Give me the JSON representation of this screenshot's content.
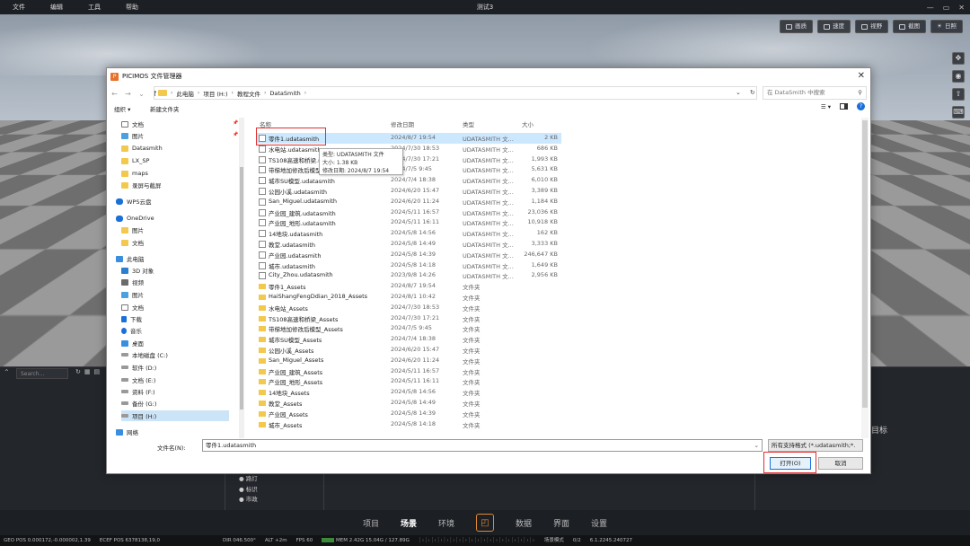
{
  "app": {
    "menu": [
      "文件",
      "编辑",
      "工具",
      "帮助"
    ],
    "title": "测试3",
    "window_controls": [
      "—",
      "▭",
      "✕"
    ]
  },
  "viewport_tools": [
    {
      "label": "画质",
      "icon": "image-icon"
    },
    {
      "label": "速度",
      "icon": "speed-icon"
    },
    {
      "label": "视野",
      "icon": "eye-icon"
    },
    {
      "label": "截图",
      "icon": "screenshot-icon"
    },
    {
      "label": "日照",
      "icon": "sun-icon"
    }
  ],
  "viewport_side_tools": [
    "✥",
    "◉",
    "⇧",
    "⌨"
  ],
  "axis": {
    "x": "X",
    "y": "Y",
    "z": "Z"
  },
  "left_panel": {
    "search_placeholder": "Search..."
  },
  "right_panel": {
    "target": "目标"
  },
  "layer_list": [
    "路灯",
    "标识",
    "市政"
  ],
  "bottom_tabs": [
    "项目",
    "场景",
    "环境",
    "数据",
    "界面",
    "设置"
  ],
  "active_tab": "场景",
  "status_bar": {
    "geo_pos": "GEO POS  0.000172,-0.000002,1.39",
    "ecef_pos": "ECEF POS  6378138,19,0",
    "dir": "DIR  046.500°",
    "alt": "ALT  +2m",
    "fps": "FPS  60",
    "mem": "MEM  2.42G  15.04G / 127.89G",
    "mode": "场景模式",
    "count": "0/2",
    "version": "6.1.2245.240727"
  },
  "dialog": {
    "title": "PICIMOS 文件管理器",
    "logo_letter": "P",
    "breadcrumb": [
      "此电脑",
      "项目 (H:)",
      "教程文件",
      "DataSmith"
    ],
    "search_placeholder": "在 DataSmith 中搜索",
    "organize": "组织 ▾",
    "new_folder": "新建文件夹",
    "columns": {
      "name": "名称",
      "date": "修改日期",
      "type": "类型",
      "size": "大小"
    },
    "nav": [
      {
        "label": "文档",
        "icon": "doc",
        "pinned": true
      },
      {
        "label": "图片",
        "icon": "pic",
        "pinned": true
      },
      {
        "label": "Datasmith",
        "icon": "f"
      },
      {
        "label": "LX_SP",
        "icon": "f"
      },
      {
        "label": "maps",
        "icon": "f"
      },
      {
        "label": "录屏与截屏",
        "icon": "f"
      },
      {
        "label": "WPS云盘",
        "icon": "cloud",
        "root": true
      },
      {
        "label": "OneDrive",
        "icon": "cloud",
        "root": true
      },
      {
        "label": "图片",
        "icon": "f"
      },
      {
        "label": "文档",
        "icon": "f"
      },
      {
        "label": "此电脑",
        "icon": "pc",
        "root": true
      },
      {
        "label": "3D 对象",
        "icon": "obj"
      },
      {
        "label": "视频",
        "icon": "vid"
      },
      {
        "label": "图片",
        "icon": "pic"
      },
      {
        "label": "文档",
        "icon": "doc"
      },
      {
        "label": "下载",
        "icon": "dl"
      },
      {
        "label": "音乐",
        "icon": "music"
      },
      {
        "label": "桌面",
        "icon": "pc"
      },
      {
        "label": "本地磁盘 (C:)",
        "icon": "drv"
      },
      {
        "label": "软件 (D:)",
        "icon": "drv"
      },
      {
        "label": "文档 (E:)",
        "icon": "drv"
      },
      {
        "label": "资料 (F:)",
        "icon": "drv"
      },
      {
        "label": "备份 (G:)",
        "icon": "drv"
      },
      {
        "label": "项目 (H:)",
        "icon": "drv",
        "selected": true
      },
      {
        "label": "网络",
        "icon": "net",
        "root": true
      }
    ],
    "files": [
      {
        "name": "零件1.udatasmith",
        "date": "2024/8/7 19:54",
        "type": "UDATASMITH 文...",
        "size": "2 KB",
        "kind": "file",
        "selected": true
      },
      {
        "name": "水电站.udatasmith",
        "date": "2024/7/30 18:53",
        "type": "UDATASMITH 文...",
        "size": "686 KB",
        "kind": "file"
      },
      {
        "name": "TS108高速和桥梁.udatasmith",
        "date": "2024/7/30 17:21",
        "type": "UDATASMITH 文...",
        "size": "1,993 KB",
        "kind": "file"
      },
      {
        "name": "带梯地加修改后模型.udatasmith",
        "date": "2024/7/5 9:45",
        "type": "UDATASMITH 文...",
        "size": "5,631 KB",
        "kind": "file"
      },
      {
        "name": "城市SU模型.udatasmith",
        "date": "2024/7/4 18:38",
        "type": "UDATASMITH 文...",
        "size": "6,010 KB",
        "kind": "file"
      },
      {
        "name": "公园小溪.udatasmith",
        "date": "2024/6/20 15:47",
        "type": "UDATASMITH 文...",
        "size": "3,389 KB",
        "kind": "file"
      },
      {
        "name": "San_Miguel.udatasmith",
        "date": "2024/6/20 11:24",
        "type": "UDATASMITH 文...",
        "size": "1,184 KB",
        "kind": "file"
      },
      {
        "name": "产业园_建筑.udatasmith",
        "date": "2024/5/11 16:57",
        "type": "UDATASMITH 文...",
        "size": "23,036 KB",
        "kind": "file"
      },
      {
        "name": "产业园_地形.udatasmith",
        "date": "2024/5/11 16:11",
        "type": "UDATASMITH 文...",
        "size": "10,918 KB",
        "kind": "file"
      },
      {
        "name": "14地块.udatasmith",
        "date": "2024/5/8 14:56",
        "type": "UDATASMITH 文...",
        "size": "162 KB",
        "kind": "file"
      },
      {
        "name": "教堂.udatasmith",
        "date": "2024/5/8 14:49",
        "type": "UDATASMITH 文...",
        "size": "3,333 KB",
        "kind": "file"
      },
      {
        "name": "产业园.udatasmith",
        "date": "2024/5/8 14:39",
        "type": "UDATASMITH 文...",
        "size": "246,647 KB",
        "kind": "file"
      },
      {
        "name": "城市.udatasmith",
        "date": "2024/5/8 14:18",
        "type": "UDATASMITH 文...",
        "size": "1,649 KB",
        "kind": "file"
      },
      {
        "name": "City_Zhou.udatasmith",
        "date": "2023/9/8 14:26",
        "type": "UDATASMITH 文...",
        "size": "2,956 KB",
        "kind": "file"
      },
      {
        "name": "零件1_Assets",
        "date": "2024/8/7 19:54",
        "type": "文件夹",
        "size": "",
        "kind": "folder"
      },
      {
        "name": "HaiShangFengDdian_2018_Assets",
        "date": "2024/8/1 10:42",
        "type": "文件夹",
        "size": "",
        "kind": "folder"
      },
      {
        "name": "水电站_Assets",
        "date": "2024/7/30 18:53",
        "type": "文件夹",
        "size": "",
        "kind": "folder"
      },
      {
        "name": "TS108高速和桥梁_Assets",
        "date": "2024/7/30 17:21",
        "type": "文件夹",
        "size": "",
        "kind": "folder"
      },
      {
        "name": "带梯地加修改后模型_Assets",
        "date": "2024/7/5 9:45",
        "type": "文件夹",
        "size": "",
        "kind": "folder"
      },
      {
        "name": "城市SU模型_Assets",
        "date": "2024/7/4 18:38",
        "type": "文件夹",
        "size": "",
        "kind": "folder"
      },
      {
        "name": "公园小溪_Assets",
        "date": "2024/6/20 15:47",
        "type": "文件夹",
        "size": "",
        "kind": "folder"
      },
      {
        "name": "San_Miguel_Assets",
        "date": "2024/6/20 11:24",
        "type": "文件夹",
        "size": "",
        "kind": "folder"
      },
      {
        "name": "产业园_建筑_Assets",
        "date": "2024/5/11 16:57",
        "type": "文件夹",
        "size": "",
        "kind": "folder"
      },
      {
        "name": "产业园_地形_Assets",
        "date": "2024/5/11 16:11",
        "type": "文件夹",
        "size": "",
        "kind": "folder"
      },
      {
        "name": "14地块_Assets",
        "date": "2024/5/8 14:56",
        "type": "文件夹",
        "size": "",
        "kind": "folder"
      },
      {
        "name": "教堂_Assets",
        "date": "2024/5/8 14:49",
        "type": "文件夹",
        "size": "",
        "kind": "folder"
      },
      {
        "name": "产业园_Assets",
        "date": "2024/5/8 14:39",
        "type": "文件夹",
        "size": "",
        "kind": "folder"
      },
      {
        "name": "城市_Assets",
        "date": "2024/5/8 14:18",
        "type": "文件夹",
        "size": "",
        "kind": "folder"
      }
    ],
    "tooltip": [
      "类型: UDATASMITH 文件",
      "大小: 1.38 KB",
      "修改日期: 2024/8/7 19:54"
    ],
    "filename_label": "文件名(N):",
    "filename_value": "零件1.udatasmith",
    "filter": "所有支持格式 (*.udatasmith;*.",
    "open_button": "打开(O)",
    "cancel_button": "取消"
  },
  "colors": {
    "highlight": "#e03030",
    "accent": "#1a6fd8",
    "brand": "#e8712c",
    "selection": "#cce8ff"
  }
}
